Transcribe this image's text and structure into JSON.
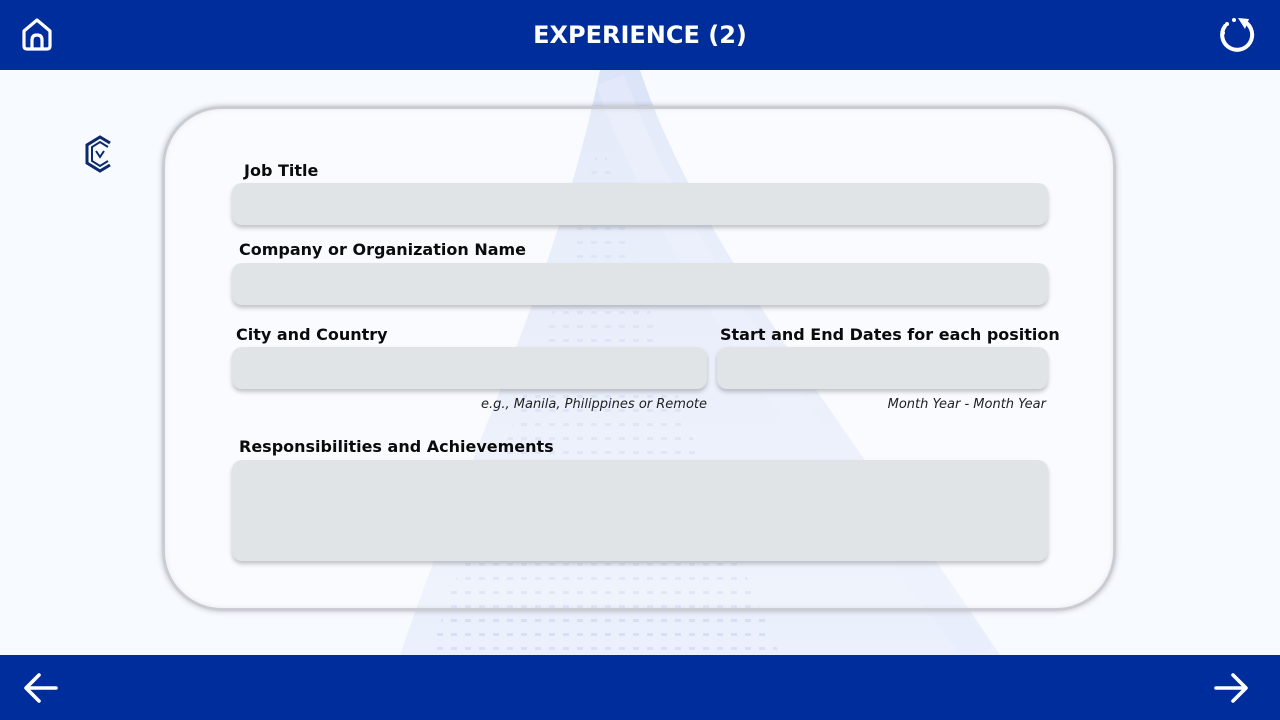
{
  "header": {
    "title": "EXPERIENCE (2)",
    "home_icon": "home-icon",
    "reload_icon": "reload-icon"
  },
  "form": {
    "job_title": {
      "label": "Job Title",
      "value": ""
    },
    "company": {
      "label": "Company or Organization Name",
      "value": ""
    },
    "city": {
      "label": "City and Country",
      "value": "",
      "hint": "e.g., Manila, Philippines or Remote"
    },
    "dates": {
      "label": "Start and End Dates for each position",
      "value": "",
      "hint": "Month Year - Month Year"
    },
    "responsibilities": {
      "label": "Responsibilities and Achievements",
      "value": ""
    }
  },
  "footer": {
    "back_icon": "arrow-left-icon",
    "next_icon": "arrow-right-icon"
  },
  "colors": {
    "brand": "#002d9c",
    "field_bg": "#e1e4e6",
    "page_bg": "#f7faff"
  }
}
